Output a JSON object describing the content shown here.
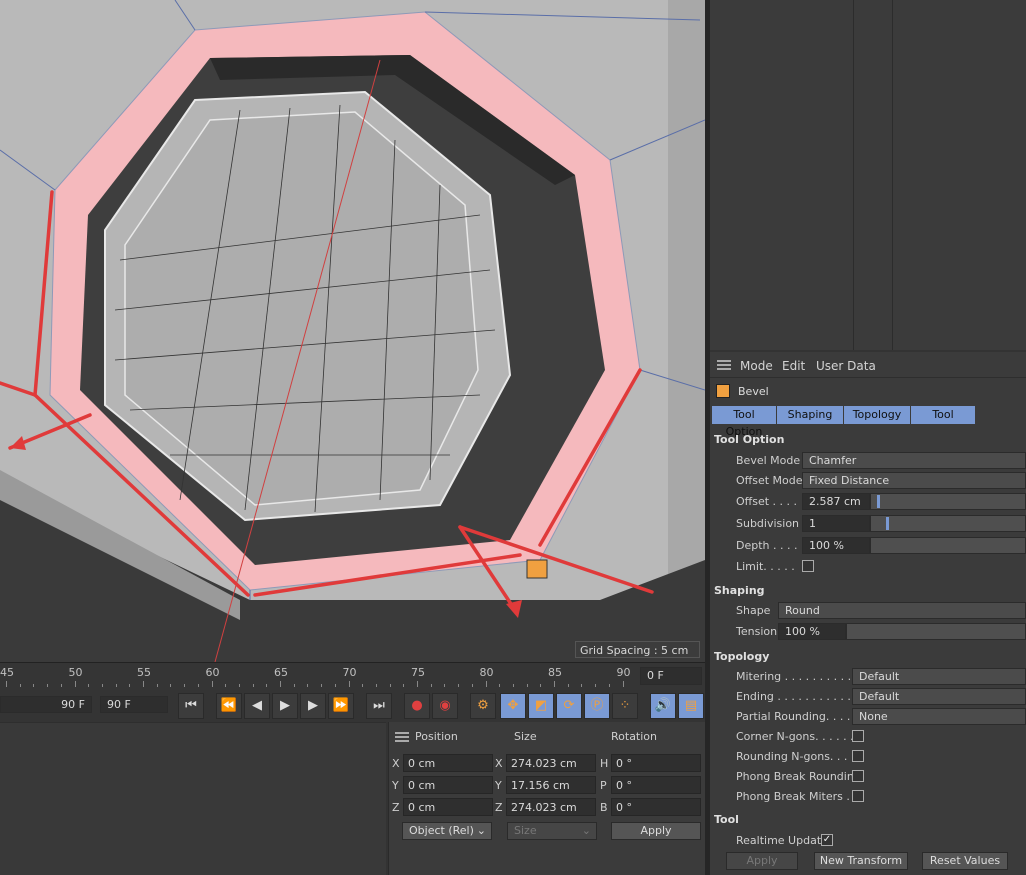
{
  "viewport": {
    "grid_spacing": "Grid Spacing : 5 cm"
  },
  "timeline": {
    "ticks": [
      "45",
      "50",
      "55",
      "60",
      "65",
      "70",
      "75",
      "80",
      "85",
      "90"
    ],
    "current_frame": "0 F",
    "end_frame_a": "90 F",
    "end_frame_b": "90 F"
  },
  "attributes": {
    "menu": {
      "mode": "Mode",
      "edit": "Edit",
      "user_data": "User Data"
    },
    "tool_name": "Bevel",
    "tabs": [
      "Tool Option",
      "Shaping",
      "Topology",
      "Tool"
    ],
    "tool_option": {
      "title": "Tool Option",
      "bevel_mode_label": "Bevel Mode",
      "bevel_mode_value": "Chamfer",
      "offset_mode_label": "Offset Mode",
      "offset_mode_value": "Fixed Distance",
      "offset_label": "Offset . . . .",
      "offset_value": "2.587 cm",
      "subdivision_label": "Subdivision",
      "subdivision_value": "1",
      "depth_label": "Depth . . . .",
      "depth_value": "100 %",
      "limit_label": "Limit. . . . ."
    },
    "shaping": {
      "title": "Shaping",
      "shape_label": "Shape",
      "shape_value": "Round",
      "tension_label": "Tension",
      "tension_value": "100 %"
    },
    "topology": {
      "title": "Topology",
      "mitering_label": "Mitering . . . . . . . . . . .",
      "mitering_value": "Default",
      "ending_label": "Ending . . . . . . . . . . . .",
      "ending_value": "Default",
      "partial_rounding_label": "Partial Rounding. . . . .",
      "partial_rounding_value": "None",
      "corner_ngons_label": "Corner N-gons. . . . . .",
      "rounding_ngons_label": "Rounding N-gons. . . .",
      "phong_break_rounding_label": "Phong Break Rounding",
      "phong_break_miters_label": "Phong Break Miters . ."
    },
    "tool": {
      "title": "Tool",
      "realtime_label": "Realtime Update",
      "apply": "Apply",
      "new_transform": "New Transform",
      "reset_values": "Reset Values"
    }
  },
  "coordinates": {
    "headers": {
      "position": "Position",
      "size": "Size",
      "rotation": "Rotation"
    },
    "rows": [
      {
        "axis": "X",
        "pos": "0 cm",
        "size_axis": "X",
        "size": "274.023 cm",
        "rot_axis": "H",
        "rot": "0 °"
      },
      {
        "axis": "Y",
        "pos": "0 cm",
        "size_axis": "Y",
        "size": "17.156 cm",
        "rot_axis": "P",
        "rot": "0 °"
      },
      {
        "axis": "Z",
        "pos": "0 cm",
        "size_axis": "Z",
        "size": "274.023 cm",
        "rot_axis": "B",
        "rot": "0 °"
      }
    ],
    "mode_select": "Object (Rel)",
    "size_select": "Size",
    "apply": "Apply"
  }
}
